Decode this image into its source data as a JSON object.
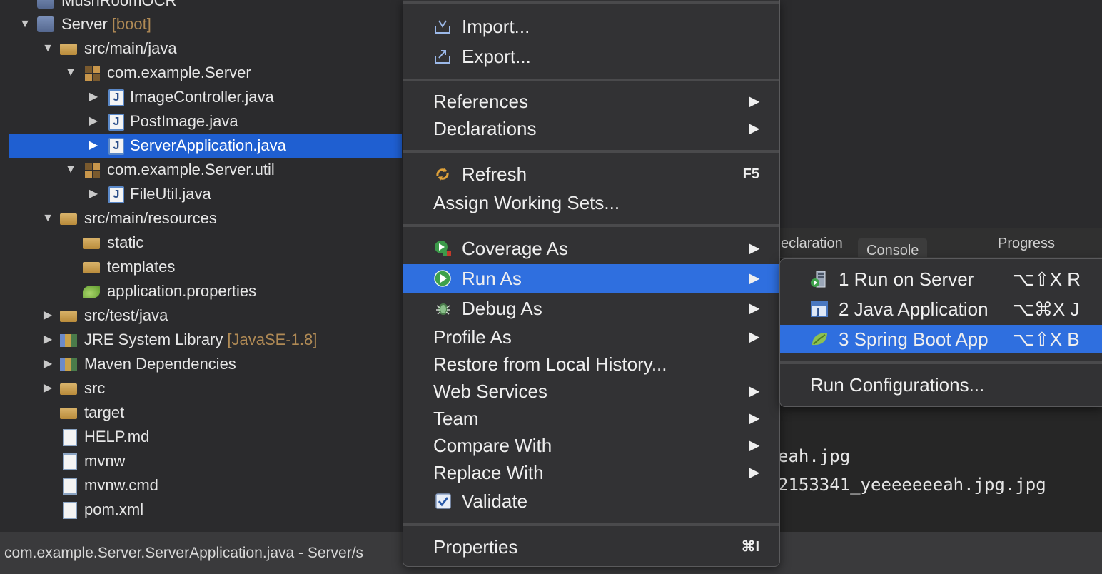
{
  "explorer": {
    "rows": [
      {
        "label": "MushRoomOCR",
        "deco": ""
      },
      {
        "label": "Server",
        "deco": "[boot]"
      },
      {
        "label": "src/main/java",
        "deco": ""
      },
      {
        "label": "com.example.Server",
        "deco": ""
      },
      {
        "label": "ImageController.java",
        "deco": ""
      },
      {
        "label": "PostImage.java",
        "deco": ""
      },
      {
        "label": "ServerApplication.java",
        "deco": ""
      },
      {
        "label": "com.example.Server.util",
        "deco": ""
      },
      {
        "label": "FileUtil.java",
        "deco": ""
      },
      {
        "label": "src/main/resources",
        "deco": ""
      },
      {
        "label": "static",
        "deco": ""
      },
      {
        "label": "templates",
        "deco": ""
      },
      {
        "label": "application.properties",
        "deco": ""
      },
      {
        "label": "src/test/java",
        "deco": ""
      },
      {
        "label": "JRE System Library",
        "deco": "[JavaSE-1.8]"
      },
      {
        "label": "Maven Dependencies",
        "deco": ""
      },
      {
        "label": "src",
        "deco": ""
      },
      {
        "label": "target",
        "deco": ""
      },
      {
        "label": "HELP.md",
        "deco": ""
      },
      {
        "label": "mvnw",
        "deco": ""
      },
      {
        "label": "mvnw.cmd",
        "deco": ""
      },
      {
        "label": "pom.xml",
        "deco": ""
      }
    ],
    "java_icon_letter": "J"
  },
  "context_menu": {
    "import": "Import...",
    "export": "Export...",
    "references": "References",
    "declarations": "Declarations",
    "refresh": "Refresh",
    "refresh_shortcut": "F5",
    "assign_working_sets": "Assign Working Sets...",
    "coverage_as": "Coverage As",
    "run_as": "Run As",
    "debug_as": "Debug As",
    "profile_as": "Profile As",
    "restore_local_history": "Restore from Local History...",
    "web_services": "Web Services",
    "team": "Team",
    "compare_with": "Compare With",
    "replace_with": "Replace With",
    "validate": "Validate",
    "properties": "Properties",
    "properties_shortcut": "⌘I",
    "submenu_arrow": "▶"
  },
  "run_as_submenu": {
    "items": [
      {
        "label": "1 Run on Server",
        "shortcut": "⌥⇧X R"
      },
      {
        "label": "2 Java Application",
        "shortcut": "⌥⌘X J"
      },
      {
        "label": "3 Spring Boot App",
        "shortcut": "⌥⇧X B"
      }
    ],
    "run_configurations": "Run Configurations..."
  },
  "console": {
    "tabs": [
      "eclaration",
      "Console",
      "Progress"
    ],
    "lines": [
      "eah.jpg",
      "2153341_yeeeeeeeah.jpg.jpg"
    ]
  },
  "statusbar": {
    "text": "com.example.Server.ServerApplication.java - Server/s"
  },
  "colors": {
    "selection": "#1f5fd1",
    "menu_highlight": "#2f6fdf",
    "menu_bg": "#323234",
    "decoration": "#b08a55"
  }
}
